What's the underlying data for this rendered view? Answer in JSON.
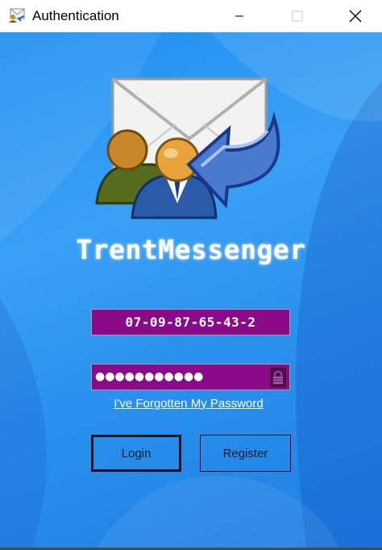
{
  "window": {
    "title": "Authentication",
    "controls": [
      "minimize",
      "maximize",
      "close"
    ]
  },
  "app": {
    "name": "TrentMessenger"
  },
  "form": {
    "username_value": "07-09-87-65-43-2",
    "password_masked": "●●●●●●●●●●●",
    "forgot_link": "I've Forgotten My Password",
    "login_label": "Login",
    "register_label": "Register"
  },
  "icons": {
    "app": "messenger-app-icon",
    "logo": "mail-users-arrow-logo",
    "password_field": "lock-icon"
  },
  "colors": {
    "background": "#1e8ff0",
    "field_fill": "#8a0a8a",
    "text": "#ffffff"
  }
}
